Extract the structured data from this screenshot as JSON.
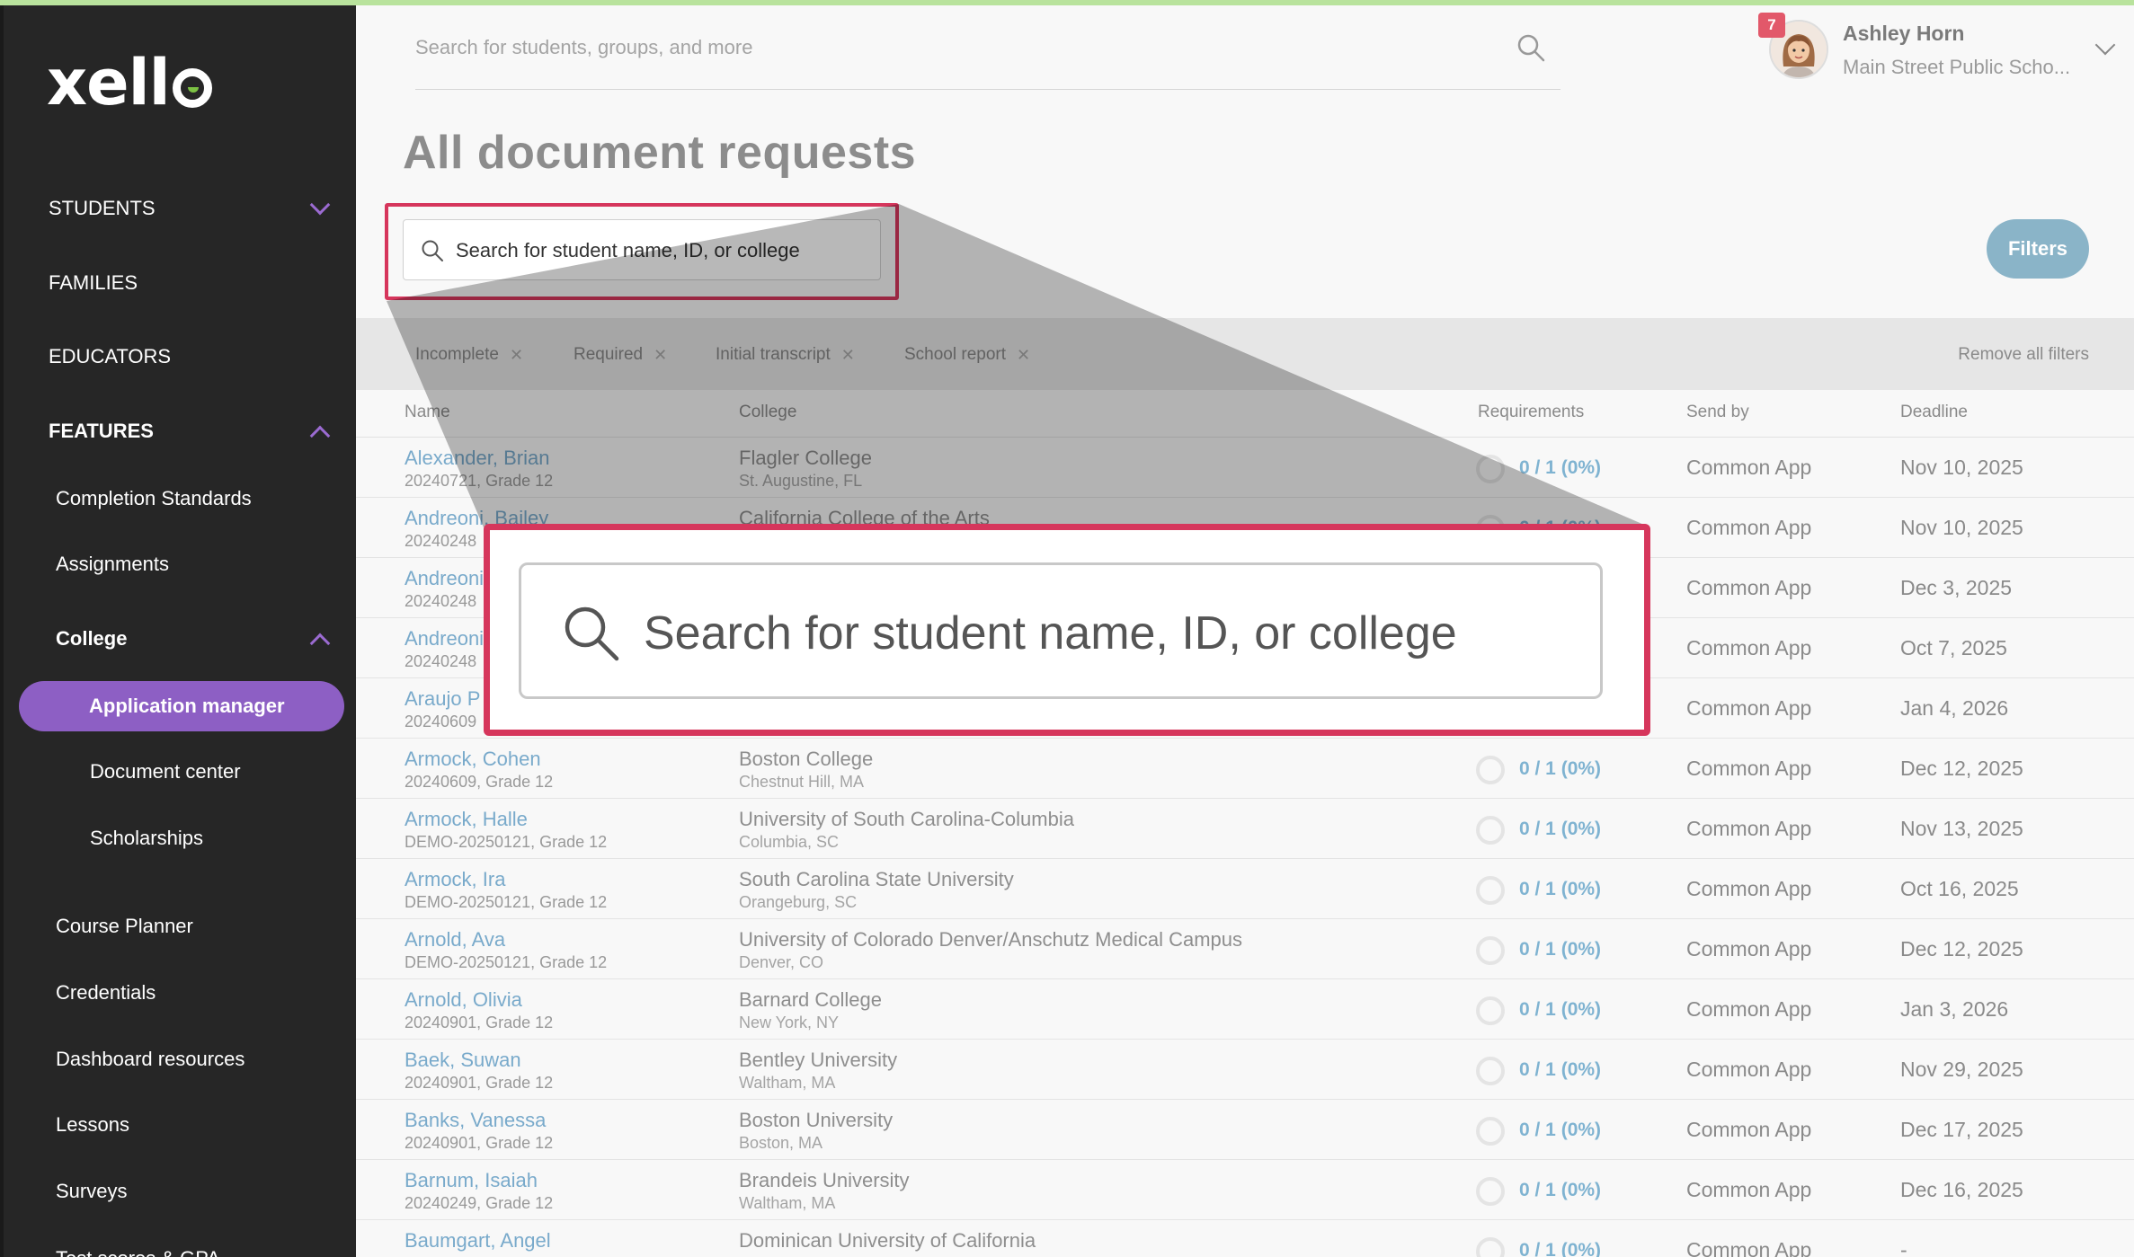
{
  "app": {
    "logo_text": "xell",
    "accent_color": "#8d5fc4",
    "highlight_color": "#d6365c"
  },
  "sidebar": {
    "students": "STUDENTS",
    "families": "FAMILIES",
    "educators": "EDUCATORS",
    "features": "FEATURES",
    "completion_standards": "Completion Standards",
    "assignments": "Assignments",
    "college": "College",
    "application_manager": "Application manager",
    "document_center": "Document center",
    "scholarships": "Scholarships",
    "course_planner": "Course Planner",
    "credentials": "Credentials",
    "dashboard_resources": "Dashboard resources",
    "lessons": "Lessons",
    "surveys": "Surveys",
    "test_scores": "Test scores & GPA"
  },
  "header": {
    "search_placeholder": "Search for students, groups, and more",
    "notification_count": "7",
    "user_name": "Ashley Horn",
    "user_school": "Main Street Public Scho..."
  },
  "page": {
    "title": "All document requests",
    "search_placeholder": "Search for student name, ID, or college",
    "filters_button": "Filters",
    "chips": [
      "Incomplete",
      "Required",
      "Initial transcript",
      "School report"
    ],
    "remove_all": "Remove all filters"
  },
  "table": {
    "headers": {
      "name": "Name",
      "college": "College",
      "requirements": "Requirements",
      "send_by": "Send by",
      "deadline": "Deadline"
    },
    "rows": [
      {
        "name": "Alexander, Brian",
        "id": "20240721, Grade 12",
        "college": "Flagler College",
        "location": "St. Augustine, FL",
        "req": "0 / 1 (0%)",
        "send_by": "Common App",
        "deadline": "Nov 10, 2025"
      },
      {
        "name": "Andreoni, Bailey",
        "id": "20240248",
        "college": "California College of the Arts",
        "location": "",
        "req": "0 / 1 (0%)",
        "send_by": "Common App",
        "deadline": "Nov 10, 2025"
      },
      {
        "name": "Andreoni",
        "id": "20240248",
        "college": "",
        "location": "",
        "req": "",
        "send_by": "Common App",
        "deadline": "Dec 3, 2025"
      },
      {
        "name": "Andreoni",
        "id": "20240248",
        "college": "",
        "location": "",
        "req": "",
        "send_by": "Common App",
        "deadline": "Oct 7, 2025"
      },
      {
        "name": "Araujo P",
        "id": "20240609",
        "college": "",
        "location": "",
        "req": "",
        "send_by": "Common App",
        "deadline": "Jan 4, 2026"
      },
      {
        "name": "Armock, Cohen",
        "id": "20240609, Grade 12",
        "college": "Boston College",
        "location": "Chestnut Hill, MA",
        "req": "0 / 1 (0%)",
        "send_by": "Common App",
        "deadline": "Dec 12, 2025"
      },
      {
        "name": "Armock, Halle",
        "id": "DEMO-20250121, Grade 12",
        "college": "University of South Carolina-Columbia",
        "location": "Columbia, SC",
        "req": "0 / 1 (0%)",
        "send_by": "Common App",
        "deadline": "Nov 13, 2025"
      },
      {
        "name": "Armock, Ira",
        "id": "DEMO-20250121, Grade 12",
        "college": "South Carolina State University",
        "location": "Orangeburg, SC",
        "req": "0 / 1 (0%)",
        "send_by": "Common App",
        "deadline": "Oct 16, 2025"
      },
      {
        "name": "Arnold, Ava",
        "id": "DEMO-20250121, Grade 12",
        "college": "University of Colorado Denver/Anschutz Medical Campus",
        "location": "Denver, CO",
        "req": "0 / 1 (0%)",
        "send_by": "Common App",
        "deadline": "Dec 12, 2025"
      },
      {
        "name": "Arnold, Olivia",
        "id": "20240901, Grade 12",
        "college": "Barnard College",
        "location": "New York, NY",
        "req": "0 / 1 (0%)",
        "send_by": "Common App",
        "deadline": "Jan 3, 2026"
      },
      {
        "name": "Baek, Suwan",
        "id": "20240901, Grade 12",
        "college": "Bentley University",
        "location": "Waltham, MA",
        "req": "0 / 1 (0%)",
        "send_by": "Common App",
        "deadline": "Nov 29, 2025"
      },
      {
        "name": "Banks, Vanessa",
        "id": "20240901, Grade 12",
        "college": "Boston University",
        "location": "Boston, MA",
        "req": "0 / 1 (0%)",
        "send_by": "Common App",
        "deadline": "Dec 17, 2025"
      },
      {
        "name": "Barnum, Isaiah",
        "id": "20240249, Grade 12",
        "college": "Brandeis University",
        "location": "Waltham, MA",
        "req": "0 / 1 (0%)",
        "send_by": "Common App",
        "deadline": "Dec 16, 2025"
      },
      {
        "name": "Baumgart, Angel",
        "id": "",
        "college": "Dominican University of California",
        "location": "",
        "req": "0 / 1 (0%)",
        "send_by": "Common App",
        "deadline": "-"
      }
    ]
  },
  "zoom": {
    "search_placeholder": "Search for student name, ID, or college"
  }
}
